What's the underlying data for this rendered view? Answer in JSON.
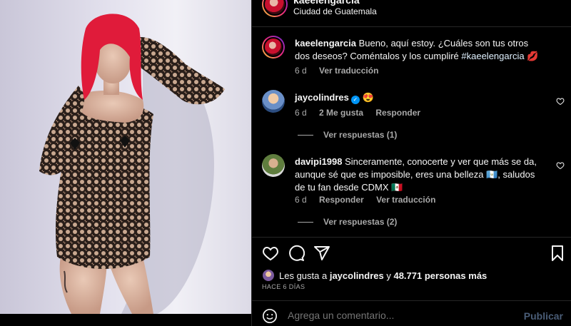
{
  "post": {
    "username": "kaeelengarcia",
    "location": "Ciudad de Guatemala"
  },
  "caption": {
    "username": "kaeelengarcia",
    "text": "Bueno, aquí estoy. ¿Cuáles son tus otros dos deseos? Coméntalos y los cumpliré ",
    "hashtag": "#kaeelengarcia",
    "emoji": "💋",
    "age": "6 d",
    "translate": "Ver traducción"
  },
  "comments": [
    {
      "username": "jaycolindres",
      "verified": true,
      "text": "😍",
      "age": "6 d",
      "likes": "2 Me gusta",
      "reply": "Responder",
      "replies": "Ver respuestas (1)"
    },
    {
      "username": "davipi1998",
      "verified": false,
      "text": "Sinceramente, conocerte y ver que más se da, aunque sé que es imposible, eres una belleza 🇬🇹, saludos de tu fan desde CDMX 🇲🇽",
      "age": "6 d",
      "reply": "Responder",
      "translate": "Ver traducción",
      "replies": "Ver respuestas (2)"
    }
  ],
  "likes": {
    "prefix": "Les gusta a ",
    "user": "jaycolindres",
    "middle": " y ",
    "count": "48.771 personas más"
  },
  "time_ago": "HACE 6 DÍAS",
  "add_comment": {
    "placeholder": "Agrega un comentario...",
    "publish": "Publicar"
  },
  "icons": {
    "like": "heart-icon",
    "comment": "comment-icon",
    "share": "share-icon",
    "save": "bookmark-icon",
    "emoji": "emoji-icon"
  }
}
